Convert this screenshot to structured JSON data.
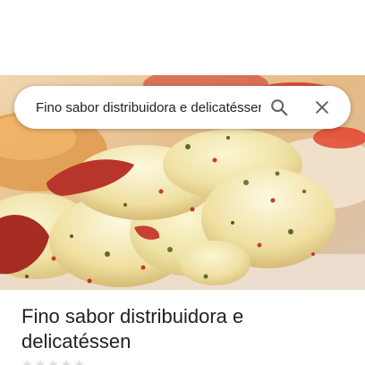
{
  "search": {
    "query": "Fino sabor distribuidora e delicatéssen"
  },
  "icons": {
    "search": "search-icon",
    "close": "close-icon",
    "star": "star-icon"
  },
  "place": {
    "title": "Fino sabor distribuidora e delicatéssen"
  },
  "colors": {
    "text_primary": "#202124",
    "icon_gray": "#5f6368",
    "cheese": "#f3e8b5",
    "pepper_red": "#b8352b"
  }
}
